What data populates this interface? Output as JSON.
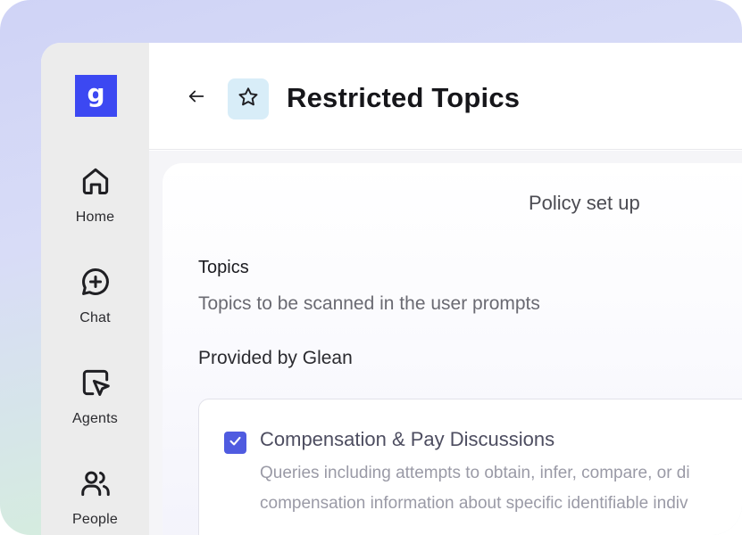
{
  "sidebar": {
    "logo_letter": "g",
    "items": [
      {
        "label": "Home",
        "icon": "home-icon"
      },
      {
        "label": "Chat",
        "icon": "chat-icon"
      },
      {
        "label": "Agents",
        "icon": "agents-icon"
      },
      {
        "label": "People",
        "icon": "people-icon"
      }
    ]
  },
  "header": {
    "title": "Restricted Topics",
    "back_icon": "arrow-left-icon",
    "page_icon": "star-icon"
  },
  "card": {
    "step_title": "Policy set up",
    "section_title": "Topics",
    "section_subtitle": "Topics to be scanned in the user prompts",
    "provided_by": "Provided by Glean",
    "topics": [
      {
        "name": "Compensation & Pay Discussions",
        "checked": true,
        "description_line1": "Queries including attempts to obtain, infer, compare, or di",
        "description_line2": "compensation information about specific identifiable indiv"
      }
    ]
  },
  "colors": {
    "brand": "#3c48f2",
    "checkbox": "#4f5be0",
    "icon_tile": "#d8edf8"
  }
}
